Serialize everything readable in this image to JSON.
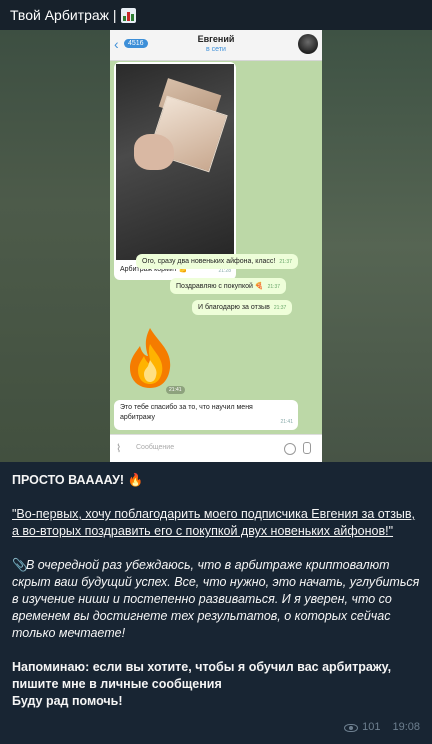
{
  "channel": {
    "title": "Твой Арбитраж |",
    "title_icon": "bar-chart-emoji"
  },
  "screenshot": {
    "back_count": "4516",
    "contact_name": "Евгений",
    "contact_status": "в сети",
    "photo_caption": "Арбитраж кормит 💪",
    "photo_time": "21:28",
    "outgoing": [
      {
        "text": "Ого, сразу два новеньких айфона, класс!",
        "time": "21:37"
      },
      {
        "text": "Поздравляю с покупкой 🍕",
        "time": "21:37"
      },
      {
        "text": "И благодарю за отзыв",
        "time": "21:37"
      }
    ],
    "sticker": "fire",
    "sticker_time": "21:41",
    "incoming_text_1": "Это тебе спасибо за то, что научил меня",
    "incoming_text_2": "арбитражу",
    "incoming_time": "21:41",
    "input_placeholder": "Сообщение"
  },
  "post": {
    "title": "ПРОСТО ВААААУ! 🔥",
    "quote": "\"Во-первых, хочу поблагодарить моего подписчика Евгения за отзыв, а во-вторых поздравить его с покупкой двух новеньких айфонов!\"",
    "body_icon": "📎",
    "body": "В очередной раз убеждаюсь, что в арбитраже криптовалют скрыт ваш будущий успех. Все, что нужно, это начать, углубиться в изучение ниши и постепенно развиваться. И я уверен, что со временем вы достигнете тех результатов, о которых сейчас только мечтаете!",
    "reminder_1": "Напоминаю: если вы хотите, чтобы я обучил вас арбитражу, пишите мне в личные сообщения",
    "reminder_2": "Буду рад помочь!",
    "views": "101",
    "time": "19:08"
  },
  "colors": {
    "background": "#17212b",
    "post_background": "#182533",
    "meta_text": "#6d7f8f",
    "chat_wallpaper": "#bcd8a7",
    "outgoing_bubble": "#eefed9"
  }
}
